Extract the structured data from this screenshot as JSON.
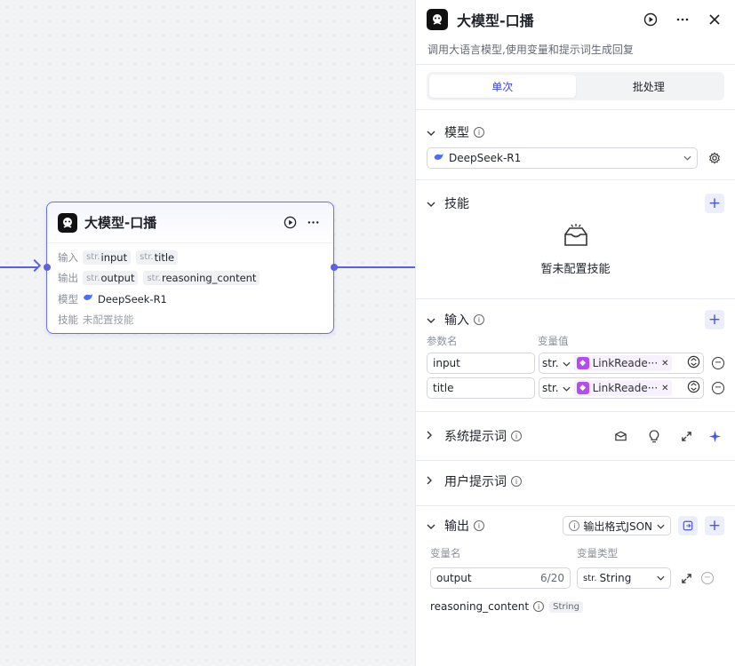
{
  "node": {
    "title": "大模型-口播",
    "input_label": "输入",
    "output_label": "输出",
    "model_label": "模型",
    "skills_label": "技能",
    "str_prefix": "str.",
    "inputs": [
      "input",
      "title"
    ],
    "outputs": [
      "output",
      "reasoning_content"
    ],
    "model": "DeepSeek-R1",
    "skills_value": "未配置技能"
  },
  "panel": {
    "title": "大模型-口播",
    "description": "调用大语言模型,使用变量和提示词生成回复",
    "tabs": [
      "单次",
      "批处理"
    ],
    "model_section": {
      "title": "模型",
      "selected": "DeepSeek-R1"
    },
    "skills_section": {
      "title": "技能",
      "empty": "暂未配置技能"
    },
    "input_section": {
      "title": "输入",
      "col_name": "参数名",
      "col_value": "变量值",
      "rows": [
        {
          "name": "input",
          "type": "str.",
          "ref": "LinkReade···"
        },
        {
          "name": "title",
          "type": "str.",
          "ref": "LinkReade···"
        }
      ]
    },
    "system_prompt": {
      "title": "系统提示词"
    },
    "user_prompt": {
      "title": "用户提示词"
    },
    "output_section": {
      "title": "输出",
      "format_label": "输出格式JSON",
      "col_name": "变量名",
      "col_type": "变量类型",
      "field_value": "output",
      "counter": "6/20",
      "type_prefix": "str.",
      "type_value": "String",
      "extra_name": "reasoning_content",
      "extra_type": "String"
    }
  },
  "colors": {
    "accent": "#5b61e6",
    "tab_active": "#3c47d8",
    "ref_icon": "#b44cf0"
  }
}
